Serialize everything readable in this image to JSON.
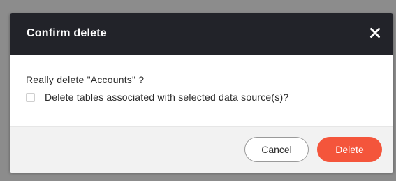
{
  "dialog": {
    "title": "Confirm delete",
    "close_icon": "close-icon",
    "question": "Really delete \"Accounts\" ?",
    "checkbox": {
      "label": "Delete tables associated with selected data source(s)?",
      "checked": false
    }
  },
  "footer": {
    "cancel_label": "Cancel",
    "delete_label": "Delete"
  },
  "colors": {
    "header_bg": "#222329",
    "delete_accent": "#f4553b",
    "overlay": "#8c8c8c"
  }
}
